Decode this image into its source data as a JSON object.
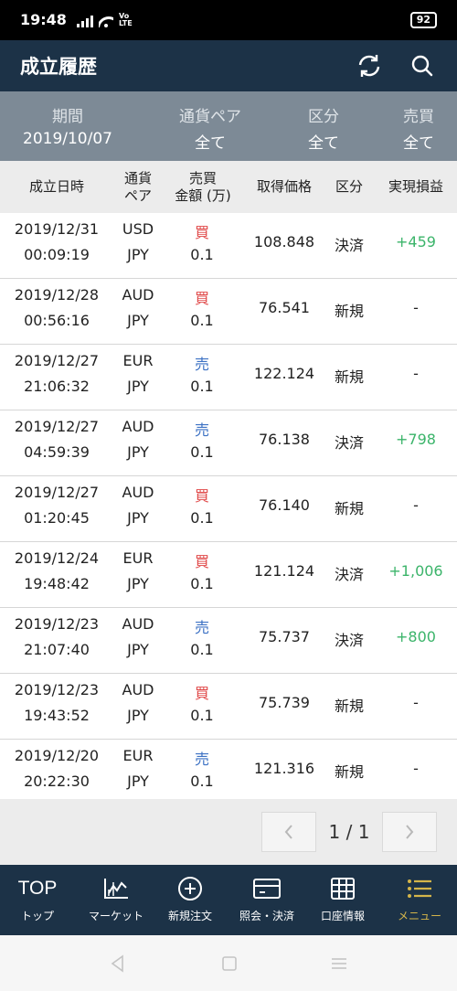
{
  "status": {
    "time": "19:48",
    "volte": "VoLTE",
    "battery": "92"
  },
  "header": {
    "title": "成立履歴"
  },
  "filters": [
    {
      "label": "期間",
      "value": "2019/10/07"
    },
    {
      "label": "通貨ペア",
      "value": "全て"
    },
    {
      "label": "区分",
      "value": "全て"
    },
    {
      "label": "売買",
      "value": "全て"
    }
  ],
  "table": {
    "headers": {
      "datetime": "成立日時",
      "pair_l1": "通貨",
      "pair_l2": "ペア",
      "amount_l1": "売買",
      "amount_l2": "金額 (万)",
      "price": "取得価格",
      "kind": "区分",
      "pl": "実現損益"
    },
    "rows": [
      {
        "date": "2019/12/31",
        "time": "00:09:19",
        "base": "USD",
        "quote": "JPY",
        "side": "買",
        "amount": "0.1",
        "price": "108.848",
        "kind": "決済",
        "pl": "+459"
      },
      {
        "date": "2019/12/28",
        "time": "00:56:16",
        "base": "AUD",
        "quote": "JPY",
        "side": "買",
        "amount": "0.1",
        "price": "76.541",
        "kind": "新規",
        "pl": "-"
      },
      {
        "date": "2019/12/27",
        "time": "21:06:32",
        "base": "EUR",
        "quote": "JPY",
        "side": "売",
        "amount": "0.1",
        "price": "122.124",
        "kind": "新規",
        "pl": "-"
      },
      {
        "date": "2019/12/27",
        "time": "04:59:39",
        "base": "AUD",
        "quote": "JPY",
        "side": "売",
        "amount": "0.1",
        "price": "76.138",
        "kind": "決済",
        "pl": "+798"
      },
      {
        "date": "2019/12/27",
        "time": "01:20:45",
        "base": "AUD",
        "quote": "JPY",
        "side": "買",
        "amount": "0.1",
        "price": "76.140",
        "kind": "新規",
        "pl": "-"
      },
      {
        "date": "2019/12/24",
        "time": "19:48:42",
        "base": "EUR",
        "quote": "JPY",
        "side": "買",
        "amount": "0.1",
        "price": "121.124",
        "kind": "決済",
        "pl": "+1,006"
      },
      {
        "date": "2019/12/23",
        "time": "21:07:40",
        "base": "AUD",
        "quote": "JPY",
        "side": "売",
        "amount": "0.1",
        "price": "75.737",
        "kind": "決済",
        "pl": "+800"
      },
      {
        "date": "2019/12/23",
        "time": "19:43:52",
        "base": "AUD",
        "quote": "JPY",
        "side": "買",
        "amount": "0.1",
        "price": "75.739",
        "kind": "新規",
        "pl": "-"
      },
      {
        "date": "2019/12/20",
        "time": "20:22:30",
        "base": "EUR",
        "quote": "JPY",
        "side": "売",
        "amount": "0.1",
        "price": "121.316",
        "kind": "新規",
        "pl": "-"
      }
    ]
  },
  "pagination": {
    "text": "1 / 1",
    "prev_icon": "chevron-left-icon",
    "next_icon": "chevron-right-icon"
  },
  "nav": [
    {
      "label": "トップ",
      "icon": "TOP"
    },
    {
      "label": "マーケット",
      "icon": "chart-icon"
    },
    {
      "label": "新規注文",
      "icon": "plus-circle-icon"
    },
    {
      "label": "照会・決済",
      "icon": "card-icon"
    },
    {
      "label": "口座情報",
      "icon": "grid-icon"
    },
    {
      "label": "メニュー",
      "icon": "menu-icon"
    }
  ],
  "colors": {
    "header_bg": "#1c3247",
    "filter_bg": "#7d8a96",
    "buy": "#e04848",
    "sell": "#3d72c4",
    "profit": "#3bb46a",
    "active_nav": "#d4b54a"
  }
}
